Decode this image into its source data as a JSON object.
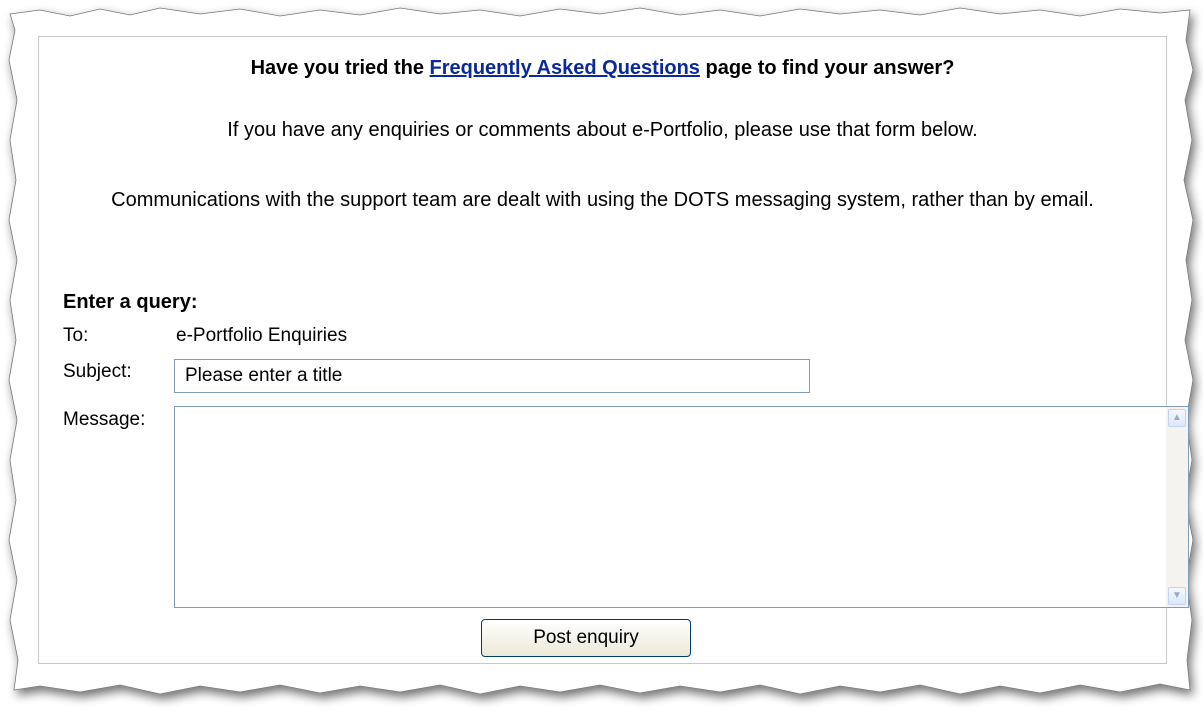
{
  "heading": {
    "prefix": "Have you tried the ",
    "link": "Frequently Asked Questions",
    "suffix": " page to find your answer?"
  },
  "intro": "If you have any enquiries or comments about e-Portfolio, please use that form below.",
  "notice": "Communications with the support team are dealt with using the DOTS messaging system, rather than by email.",
  "form": {
    "title": "Enter a query:",
    "to_label": "To:",
    "to_value": "e-Portfolio Enquiries",
    "subject_label": "Subject:",
    "subject_value": "Please enter a title",
    "message_label": "Message:",
    "message_value": "",
    "submit_label": "Post enquiry"
  },
  "icons": {
    "scroll_up": "scroll-up-arrow",
    "scroll_down": "scroll-down-arrow"
  }
}
